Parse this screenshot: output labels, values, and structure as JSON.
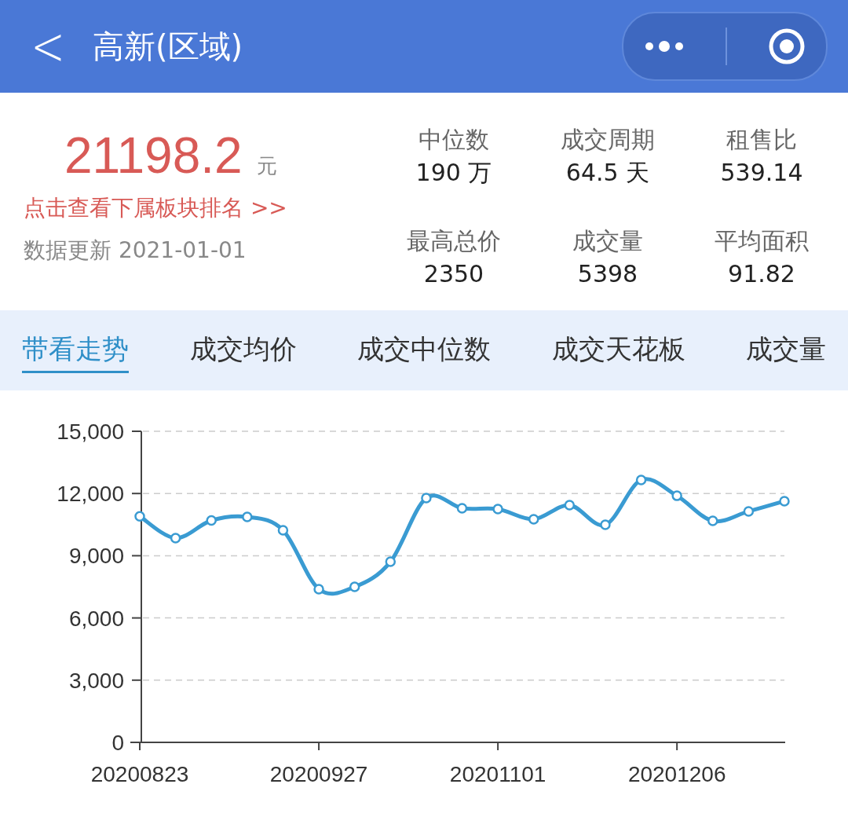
{
  "header": {
    "back": "<",
    "title": "高新(区域)"
  },
  "summary": {
    "price": "21198.2",
    "unit": "元",
    "link": "点击查看下属板块排名 >>",
    "updated": "数据更新 2021-01-01"
  },
  "stats": [
    {
      "label": "中位数",
      "value": "190 万"
    },
    {
      "label": "成交周期",
      "value": "64.5 天"
    },
    {
      "label": "租售比",
      "value": "539.14"
    },
    {
      "label": "最高总价",
      "value": "2350"
    },
    {
      "label": "成交量",
      "value": "5398"
    },
    {
      "label": "平均面积",
      "value": "91.82"
    }
  ],
  "tabs": [
    {
      "label": "带看走势",
      "selected": true
    },
    {
      "label": "成交均价",
      "selected": false
    },
    {
      "label": "成交中位数",
      "selected": false
    },
    {
      "label": "成交天花板",
      "selected": false
    },
    {
      "label": "成交量",
      "selected": false
    }
  ],
  "chart": {
    "chart_data": {
      "type": "line",
      "x": [
        "20200823",
        null,
        null,
        null,
        null,
        "20200927",
        null,
        null,
        null,
        null,
        "20201101",
        null,
        null,
        null,
        null,
        "20201206",
        null,
        null,
        null
      ],
      "ylim": [
        0,
        15000
      ],
      "grid": true,
      "yticks": [
        {
          "value": 0,
          "label": "0"
        },
        {
          "value": 3000,
          "label": "3,000"
        },
        {
          "value": 6000,
          "label": "6,000"
        },
        {
          "value": 9000,
          "label": "9,000"
        },
        {
          "value": 12000,
          "label": "12,000"
        },
        {
          "value": 15000,
          "label": "15,000"
        }
      ],
      "series": [
        {
          "color": "#3a9bd2",
          "marker": true,
          "values": [
            10900,
            9850,
            10700,
            10870,
            10230,
            7390,
            7500,
            8710,
            11780,
            11290,
            11250,
            10760,
            11440,
            10490,
            12650,
            11890,
            10680,
            11140,
            11630
          ]
        }
      ]
    }
  }
}
